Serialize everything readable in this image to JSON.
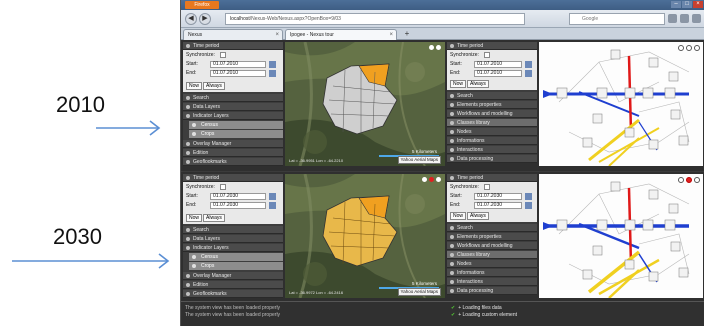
{
  "annotations": {
    "label_top": "2010",
    "label_bottom": "2030"
  },
  "browser": {
    "app_button": "Firefox",
    "url_host": "localhost",
    "url_path": "/Nexus-Web/Nexus.aspx?OpenBox=9/03",
    "search_placeholder": "Google",
    "tabs": [
      {
        "label": "Nexus"
      },
      {
        "label": "Ipogee - Nexus tour"
      }
    ]
  },
  "instances": [
    {
      "time_period": {
        "header": "Time period",
        "synchronize_label": "Synchronize:",
        "start_label": "Start:",
        "start_value": "01.07.2010",
        "end_label": "End:",
        "end_value": "01.07.2010",
        "now_button": "Now",
        "always_button": "Always"
      },
      "left_menu": [
        "Search",
        "Data Layers",
        "Indicator Layers"
      ],
      "indicator_items": [
        "Census",
        "Crops"
      ],
      "left_menu_bottom": [
        "Overlay Manager",
        "Edition",
        "Geoflookmarks"
      ],
      "map": {
        "coords": "Lat = -36.9951   Lon = -64.2210",
        "scale": "5 Kilometers",
        "aerial_button": "Yahoo Aerial Maps"
      },
      "right_menu": [
        "Time period",
        "Search",
        "Elements properties",
        "Workflows and modelling",
        "Classes library",
        "Nodes",
        "Informations",
        "Interactions",
        "Data processing"
      ],
      "right_time": {
        "synchronize_label": "Synchronize:",
        "start_label": "Start:",
        "start_value": "01.07.2010",
        "end_label": "End:",
        "end_value": "01.07.2010",
        "now_button": "Now",
        "always_button": "Always"
      }
    },
    {
      "time_period": {
        "header": "Time period",
        "synchronize_label": "Synchronize:",
        "start_label": "Start:",
        "start_value": "01.07.2030",
        "end_label": "End:",
        "end_value": "01.07.2030",
        "now_button": "Now",
        "always_button": "Always"
      },
      "left_menu": [
        "Search",
        "Data Layers",
        "Indicator Layers"
      ],
      "indicator_items": [
        "Census",
        "Crops"
      ],
      "left_menu_bottom": [
        "Overlay Manager",
        "Edition",
        "Geoflookmarks"
      ],
      "map": {
        "coords": "Lat = -36.9972   Lon = -64.2416",
        "scale": "5 Kilometers",
        "aerial_button": "Yahoo Aerial Maps"
      },
      "right_menu": [
        "Time period",
        "Search",
        "Elements properties",
        "Workflows and modelling",
        "Classes library",
        "Nodes",
        "Informations",
        "Interactions",
        "Data processing"
      ],
      "right_time": {
        "synchronize_label": "Synchronize:",
        "start_label": "Start:",
        "start_value": "01.07.2030",
        "end_label": "End:",
        "end_value": "01.07.2030",
        "now_button": "Now",
        "always_button": "Always"
      }
    }
  ],
  "status": {
    "left_lines": [
      "The system view has been loaded properly",
      "The system view has been loaded properly"
    ],
    "right_lines": [
      "+ Loading files data",
      "+ Loading custom element"
    ]
  },
  "colors": {
    "map_zone_2010": "#c9c9c9",
    "map_zone_2030": "#e8b84a",
    "highlight_orange": "#f0a020",
    "diagram_blue": "#1f3fd0",
    "diagram_yellow": "#f0d020",
    "diagram_red": "#e01818",
    "arrow_blue": "#5b8fd4"
  }
}
